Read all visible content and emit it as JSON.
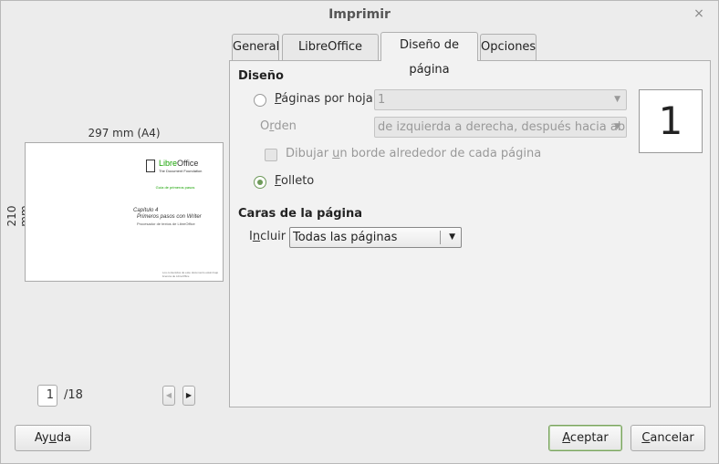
{
  "window": {
    "title": "Imprimir",
    "close_glyph": "×"
  },
  "preview": {
    "width_label": "297 mm (A4)",
    "height_label": "210 mm",
    "page": {
      "logo_name_green": "Libre",
      "logo_name_rest": "Office",
      "logo_sub": "The Document Foundation",
      "guide": "Guía de primeros pasos",
      "chapter": "Capítulo 4",
      "chapter_title": "Primeros pasos con Writer",
      "chapter_sub": "Procesador de textos de LibreOffice",
      "footer": "Los contenidos de este documento están bajo licencia de LibreOffice"
    },
    "current_page": "1",
    "total_pages": "/18",
    "prev_glyph": "◀",
    "next_glyph": "▶"
  },
  "tabs": [
    {
      "label": "General"
    },
    {
      "label": "LibreOffice Writer"
    },
    {
      "label": "Diseño de página",
      "active": true
    },
    {
      "label": "Opciones"
    }
  ],
  "layout": {
    "section_title": "Diseño",
    "pages_per_sheet": {
      "prefix": "",
      "accel": "P",
      "rest": "áginas por hoja",
      "value": "1"
    },
    "order": {
      "prefix": "O",
      "accel": "r",
      "rest": "den",
      "value": "de izquierda a derecha, después hacia abajo"
    },
    "draw_border": {
      "prefix": "Dibujar ",
      "accel": "u",
      "rest": "n borde alrededor de cada página"
    },
    "brochure": {
      "prefix": "",
      "accel": "F",
      "rest": "olleto"
    },
    "preview_number": "1"
  },
  "sides": {
    "section_title": "Caras de la página",
    "include": {
      "prefix": "I",
      "accel": "n",
      "rest": "cluir",
      "value": "Todas las páginas"
    }
  },
  "buttons": {
    "help": {
      "prefix": "Ay",
      "accel": "u",
      "rest": "da"
    },
    "ok": {
      "prefix": "",
      "accel": "A",
      "rest": "ceptar"
    },
    "cancel": {
      "prefix": "",
      "accel": "C",
      "rest": "ancelar"
    }
  },
  "arrow_glyph": "▼"
}
